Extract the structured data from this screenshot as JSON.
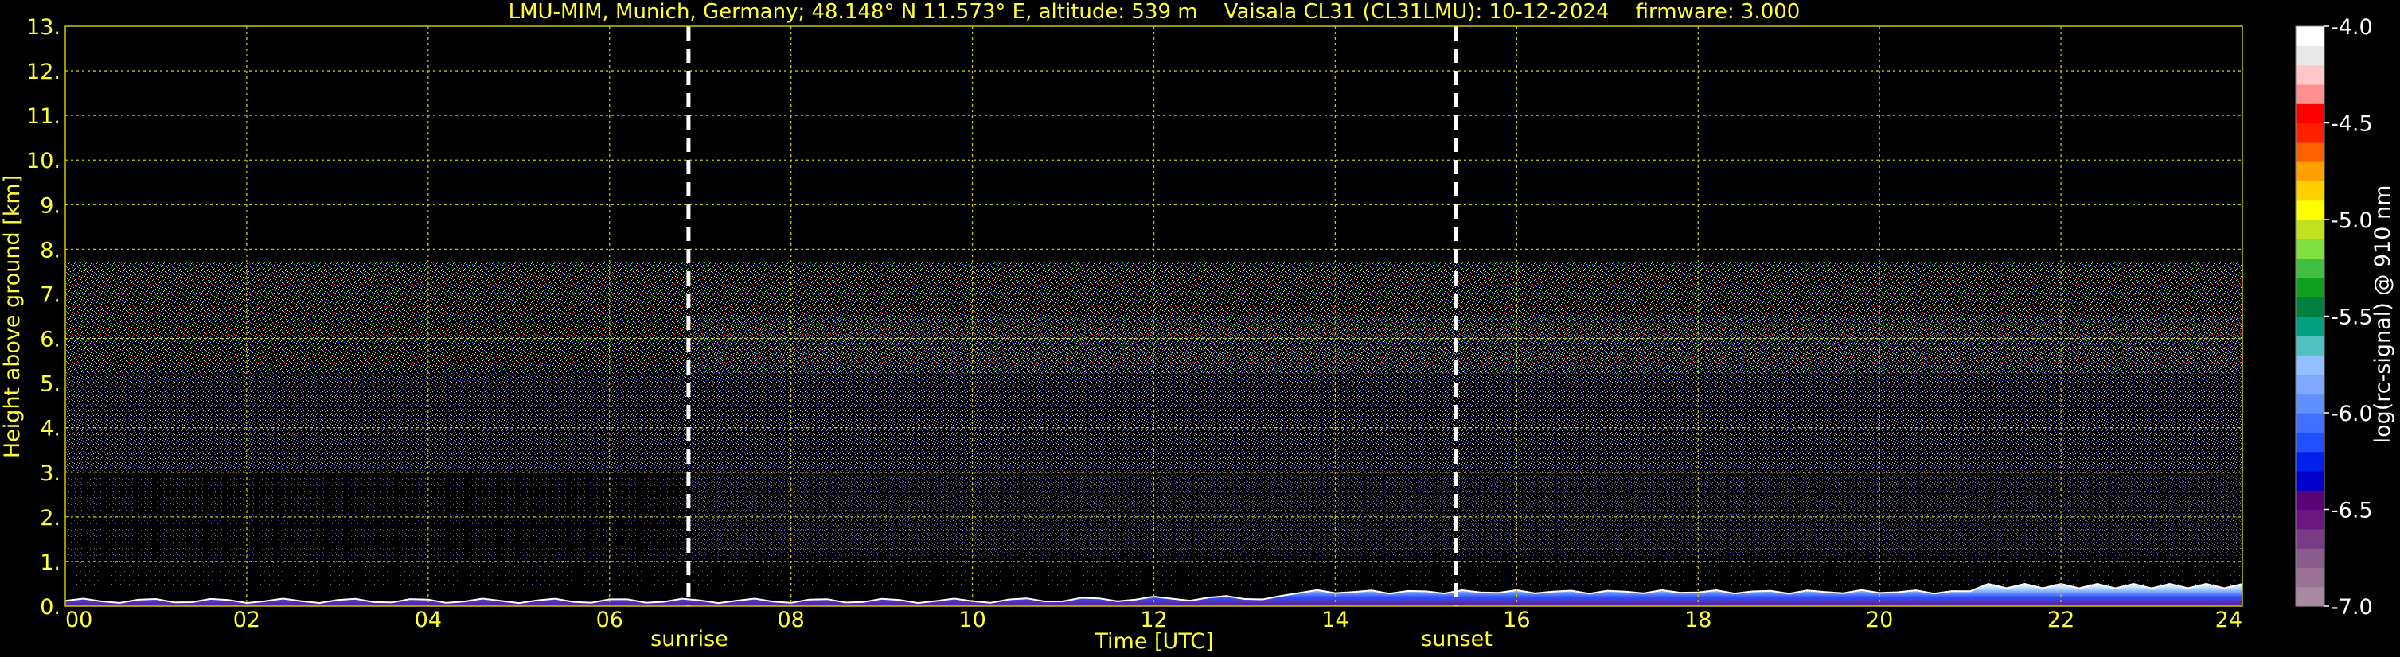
{
  "title": "LMU-MIM, Munich, Germany; 48.148° N 11.573° E, altitude: 539 m    Vaisala CL31 (CL31LMU): 10-12-2024    firmware: 3.000",
  "colors": {
    "axis_text": "#ffff33",
    "grid": "#c8c800",
    "background": "#000000",
    "sun_lines": "#ffffff"
  },
  "chart_data": {
    "type": "heatmap",
    "title": "LMU-MIM, Munich, Germany; 48.148° N 11.573° E, altitude: 539 m    Vaisala CL31 (CL31LMU): 10-12-2024    firmware: 3.000",
    "xlabel": "Time [UTC]",
    "ylabel": "Height above ground [km]",
    "x_ticks": [
      "00",
      "02",
      "04",
      "06",
      "08",
      "10",
      "12",
      "14",
      "16",
      "18",
      "20",
      "22",
      "24"
    ],
    "x_tick_values": [
      0,
      2,
      4,
      6,
      8,
      10,
      12,
      14,
      16,
      18,
      20,
      22,
      24
    ],
    "y_ticks": [
      "0.",
      "1.",
      "2.",
      "3.",
      "4.",
      "5.",
      "6.",
      "7.",
      "8.",
      "9.",
      "10.",
      "11.",
      "12.",
      "13."
    ],
    "y_tick_values": [
      0,
      1,
      2,
      3,
      4,
      5,
      6,
      7,
      8,
      9,
      10,
      11,
      12,
      13
    ],
    "xlim": [
      0,
      24
    ],
    "ylim": [
      0,
      13
    ],
    "grid": true,
    "annotations": [
      {
        "text": "sunrise",
        "x": 6.87
      },
      {
        "text": "sunset",
        "x": 15.33
      }
    ],
    "signal_max_height_km": 7.7,
    "colorbar": {
      "label": "log(rc-signal) @ 910 nm",
      "range": [
        -7.0,
        -4.0
      ],
      "ticks": [
        "-4.0",
        "-4.5",
        "-5.0",
        "-5.5",
        "-6.0",
        "-6.5",
        "-7.0"
      ],
      "tick_values": [
        -4.0,
        -4.5,
        -5.0,
        -5.5,
        -6.0,
        -6.5,
        -7.0
      ],
      "colors": [
        "#a88aa0",
        "#9a7296",
        "#8a5c8e",
        "#7a3a86",
        "#6a1880",
        "#5a0478",
        "#0000cc",
        "#0020ee",
        "#2050ff",
        "#4070ff",
        "#6090ff",
        "#80a8ff",
        "#90c0ff",
        "#50c0c0",
        "#00a080",
        "#008040",
        "#10a020",
        "#40c040",
        "#80e040",
        "#c0e020",
        "#ffff00",
        "#ffd000",
        "#ffa000",
        "#ff6000",
        "#ff2000",
        "#ff0000",
        "#ff9090",
        "#ffc8c8",
        "#e8e8e8",
        "#ffffff"
      ]
    }
  }
}
